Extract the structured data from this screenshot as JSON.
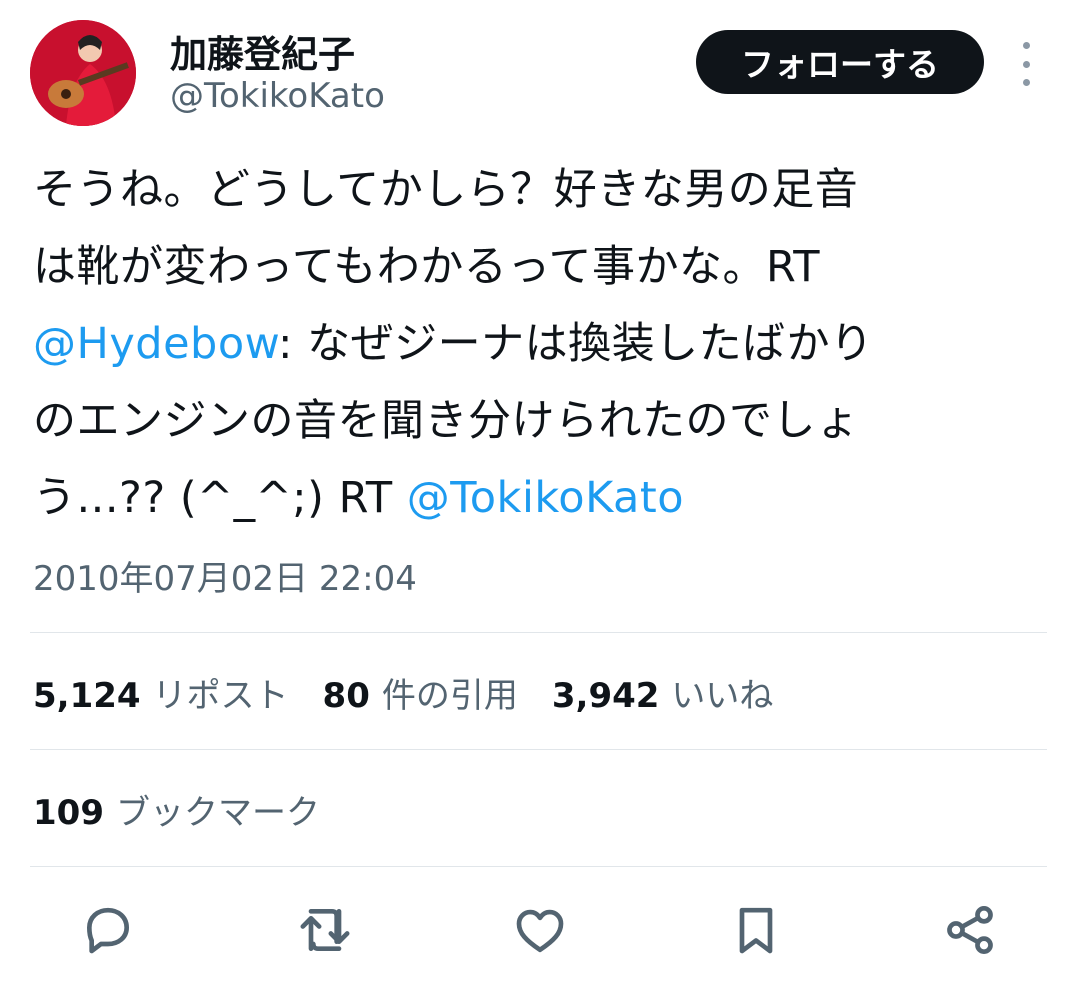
{
  "author": {
    "display_name": "加藤登紀子",
    "handle": "@TokikoKato"
  },
  "follow_button_label": "フォローする",
  "tweet": {
    "lines": [
      {
        "text": "そうね。どうしてかしら？好きな男の足音"
      },
      {
        "text": "は靴が変わってもわかるって事かな。RT"
      },
      {
        "mention": "@Hydebow",
        "text": ": なぜジーナは換装したばかり"
      },
      {
        "text": "のエンジンの音を聞き分けられたのでしょ"
      },
      {
        "text": "う...?? (^_^;) RT ",
        "mention": "@TokikoKato"
      }
    ],
    "timestamp": "2010年07月02日 22:04"
  },
  "stats": {
    "reposts": {
      "count": "5,124",
      "label": "リポスト"
    },
    "quotes": {
      "count": "80",
      "label": "件の引用"
    },
    "likes": {
      "count": "3,942",
      "label": "いいね"
    },
    "bookmarks": {
      "count": "109",
      "label": "ブックマーク"
    }
  },
  "colors": {
    "accent": "#1d9bf0",
    "secondary_text": "#536471",
    "primary_text": "#0f1419",
    "follow_bg": "#0f1419"
  },
  "icons": [
    "reply-icon",
    "repost-icon",
    "like-icon",
    "bookmark-icon",
    "share-icon",
    "more-icon"
  ]
}
